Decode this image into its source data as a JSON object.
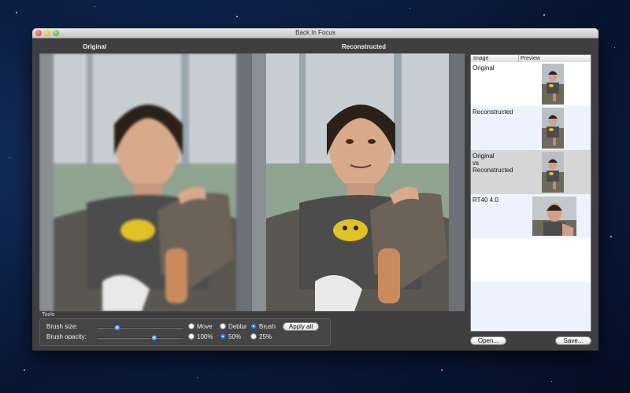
{
  "window": {
    "title": "Back In Focus"
  },
  "panels": {
    "original_title": "Original",
    "reconstructed_title": "Reconstructed"
  },
  "tools": {
    "section_label": "Tools",
    "brush_size_label": "Brush size:",
    "brush_opacity_label": "Brush opacity:",
    "brush_size_value": 0.22,
    "brush_opacity_value": 0.68,
    "modes": [
      {
        "label": "Move",
        "selected": false
      },
      {
        "label": "Deblur",
        "selected": false
      },
      {
        "label": "Brush",
        "selected": true
      }
    ],
    "opacities": [
      {
        "label": "100%",
        "selected": false
      },
      {
        "label": "50%",
        "selected": true
      },
      {
        "label": "25%",
        "selected": false
      }
    ],
    "apply_all_label": "Apply all"
  },
  "image_list": {
    "headers": {
      "image": "Image",
      "preview": "Preview"
    },
    "items": [
      {
        "label": "Original"
      },
      {
        "label": "Reconstructed"
      },
      {
        "label": "Original\nvs\nReconstructed"
      },
      {
        "label": "RT40 4.0"
      }
    ]
  },
  "buttons": {
    "open_label": "Open...",
    "save_label": "Save..."
  },
  "colors": {
    "selected_row": "#d6d6d6",
    "alt_row": "#edf3fe",
    "accent": "#3483e6"
  }
}
